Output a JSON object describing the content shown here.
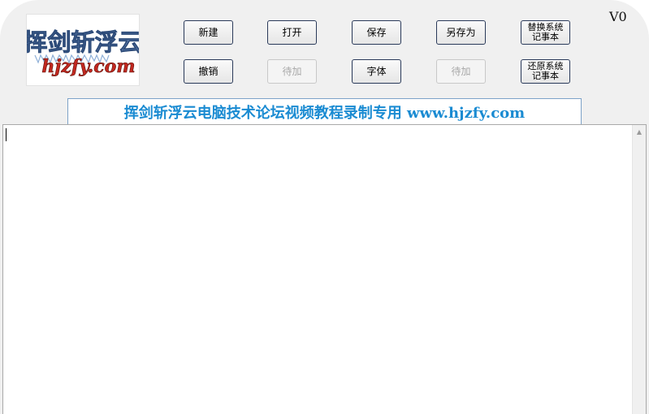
{
  "app": {
    "version_label": "V0",
    "logo_text": "挥剑斩浮云",
    "logo_domain": "hjzfy.com"
  },
  "toolbar": {
    "row1": [
      {
        "label": "新建",
        "enabled": true
      },
      {
        "label": "打开",
        "enabled": true
      },
      {
        "label": "保存",
        "enabled": true
      },
      {
        "label": "另存为",
        "enabled": true
      },
      {
        "label": "替换系统\n记事本",
        "enabled": true
      }
    ],
    "row2": [
      {
        "label": "撤销",
        "enabled": true
      },
      {
        "label": "待加",
        "enabled": false
      },
      {
        "label": "字体",
        "enabled": true
      },
      {
        "label": "待加",
        "enabled": false
      },
      {
        "label": "还原系统\n记事本",
        "enabled": true
      }
    ]
  },
  "banner": {
    "text": "挥剑斩浮云电脑技术论坛视频教程录制专用 www.hjzfy.com"
  },
  "editor": {
    "content": ""
  },
  "colors": {
    "banner_text": "#1a8bd2",
    "logo_text": "#5a7fae",
    "logo_domain": "#c22820",
    "window_bg": "#f0f0f0"
  }
}
